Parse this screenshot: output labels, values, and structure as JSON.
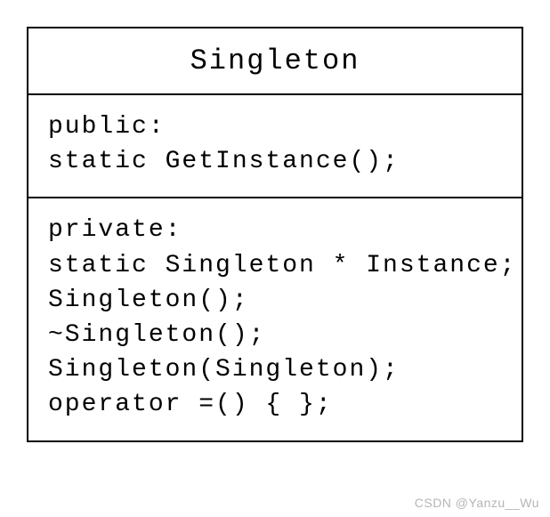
{
  "class": {
    "name": "Singleton",
    "public_section": {
      "access": "public:",
      "members": [
        "static GetInstance();"
      ]
    },
    "private_section": {
      "access": "private:",
      "members": [
        "static Singleton * Instance;",
        "Singleton();",
        "~Singleton();",
        "Singleton(Singleton);",
        "operator =() { };"
      ]
    }
  },
  "watermark": "CSDN @Yanzu__Wu"
}
